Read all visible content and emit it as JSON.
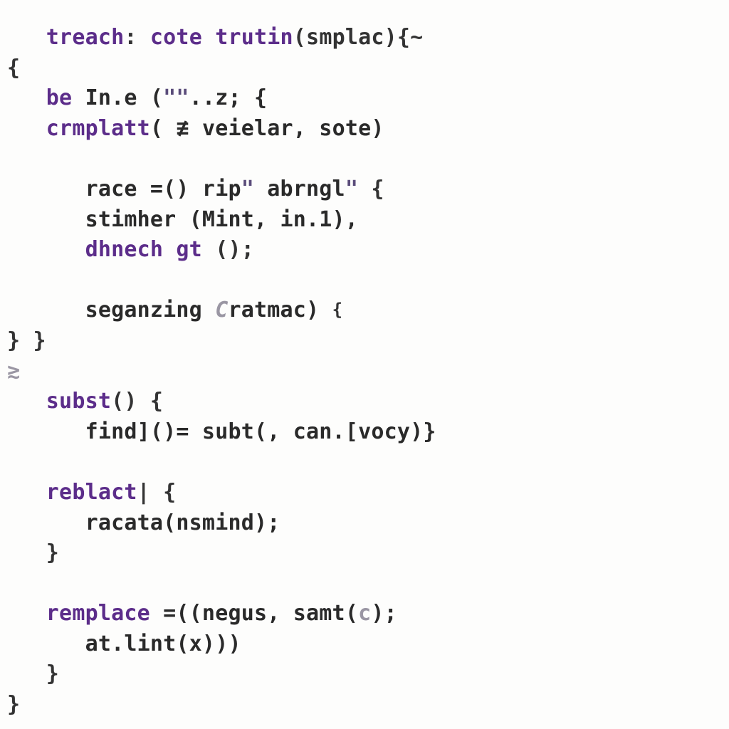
{
  "code": {
    "l1": {
      "a": "treach",
      "b": ": ",
      "c": "cote",
      "d": " ",
      "e": "trutin",
      "f": "(smplac){~"
    },
    "l2": {
      "a": "{"
    },
    "l3": {
      "a": "be",
      "b": " In.e (",
      "c": "\"\"",
      "d": "..z; {"
    },
    "l4": {
      "a": "cr",
      "b": "m",
      "c": "platt",
      "d": "( ≢ veielar, sote)"
    },
    "l5": {
      "a": "race",
      "b": " =() rip",
      "c": "\"",
      "d": " abrngl",
      "e": "\"",
      "f": " {"
    },
    "l6": {
      "a": "stimher (Mint, in.1),"
    },
    "l7": {
      "a": "dhnech",
      "b": " ",
      "c": "gt",
      "d": " ();"
    },
    "l8": {
      "a": "seganzing ",
      "b": "C",
      "c": "ratmac) ",
      "d": "{",
      "e": ""
    },
    "l9": {
      "a": "} }"
    },
    "l10": {
      "a": "≳"
    },
    "l11": {
      "a": "subst",
      "b": "() {"
    },
    "l12": {
      "a": "find]()= subt(, can.[vocy)}"
    },
    "l13": {
      "a": "reblact",
      "b": "| {"
    },
    "l14": {
      "a": "racata(nsmind);"
    },
    "l15": {
      "a": "}"
    },
    "l16": {
      "a": "remplace",
      "b": " =((negus, samt(",
      "c": "c",
      "d": ");"
    },
    "l17": {
      "a": "at.lint(x)))"
    },
    "l18": {
      "a": "}"
    },
    "l19": {
      "a": "}"
    }
  }
}
